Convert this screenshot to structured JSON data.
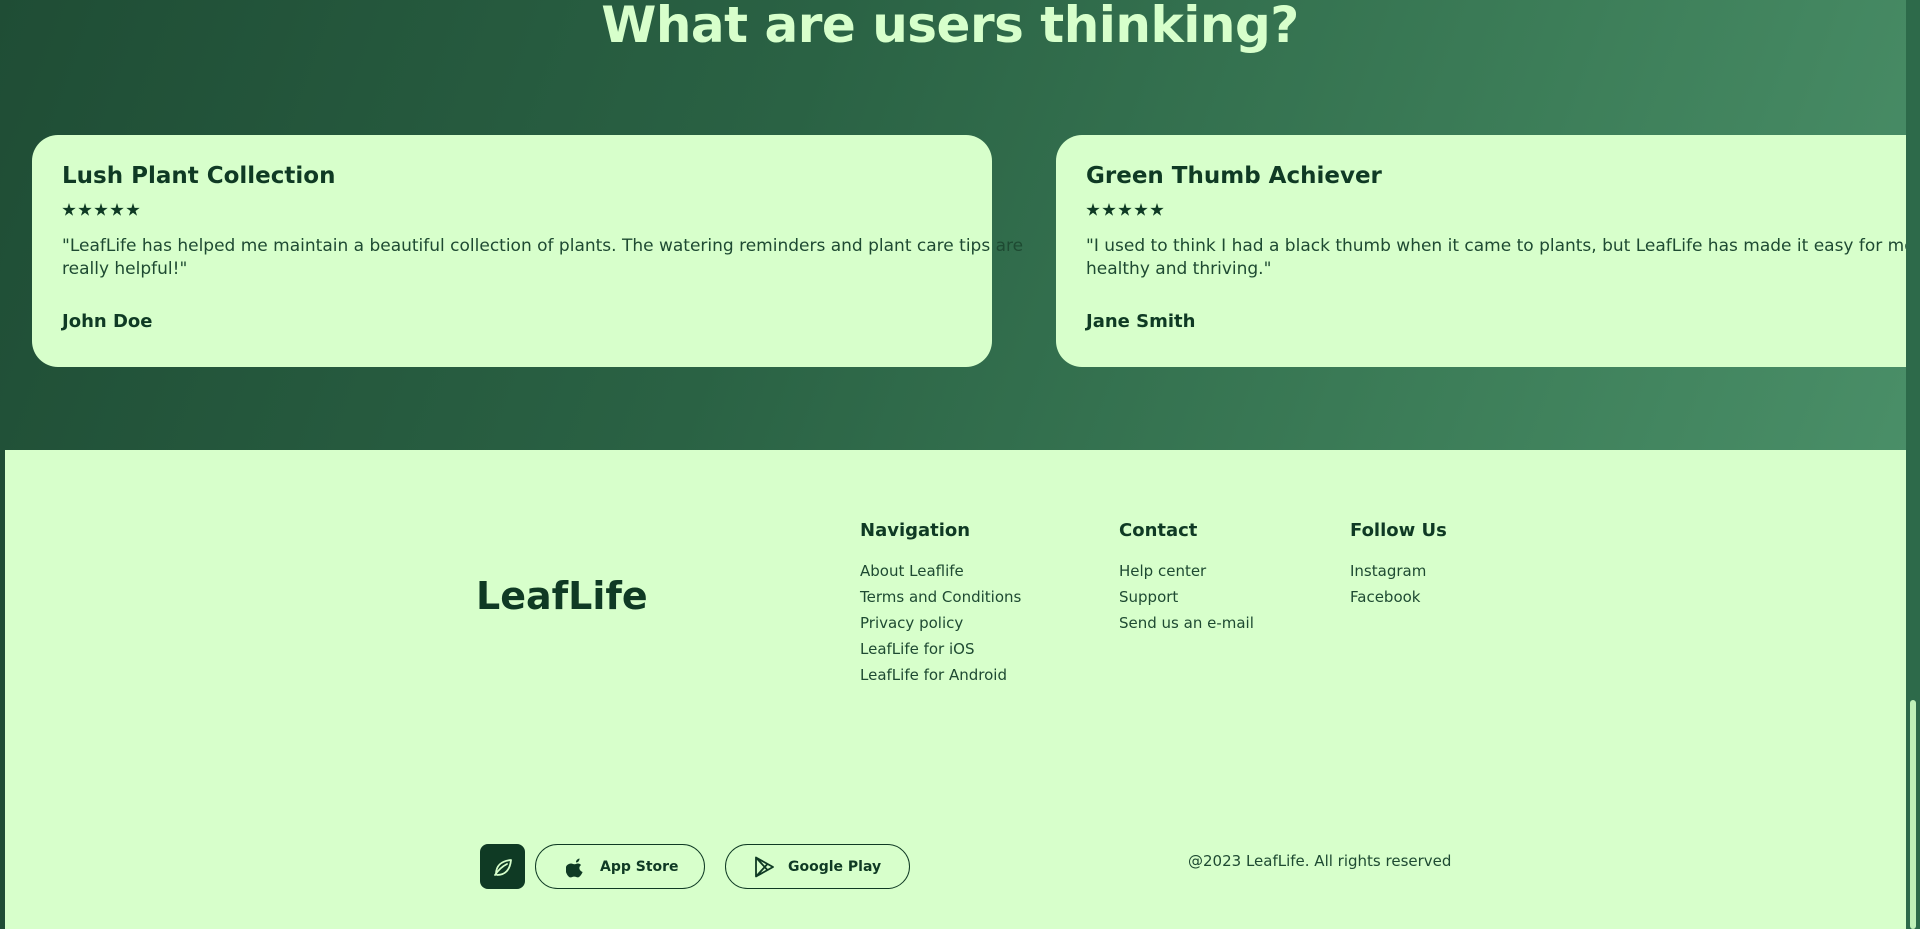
{
  "testimonials": {
    "title": "What are users thinking?",
    "cards": [
      {
        "title": "Lush Plant Collection",
        "rating": 5,
        "quote_line1": "\"LeafLife has helped me maintain a beautiful collection of plants. The watering reminders and plant care tips are",
        "quote_line2": "really helpful!\"",
        "author": "John Doe"
      },
      {
        "title": "Green Thumb Achiever",
        "rating": 5,
        "quote_line1": "\"I used to think I had a black thumb when it came to plants, but LeafLife has made it easy for me to keep",
        "quote_line2": "healthy and thriving.\"",
        "author": "Jane Smith"
      }
    ]
  },
  "footer": {
    "brand": "LeafLife",
    "navigation": {
      "title": "Navigation",
      "links": [
        "About Leaflife",
        "Terms and Conditions",
        "Privacy policy",
        "LeafLife for iOS",
        "LeafLife for Android"
      ]
    },
    "contact": {
      "title": "Contact",
      "links": [
        "Help center",
        "Support",
        "Send us an e-mail"
      ]
    },
    "follow": {
      "title": "Follow Us",
      "links": [
        "Instagram",
        "Facebook"
      ]
    },
    "app_store_label": "App Store",
    "google_play_label": "Google Play",
    "copyright": "@2023 LeafLife. All rights reserved"
  },
  "icons": {
    "leaf": "leaf-icon",
    "apple": "apple-icon",
    "play": "google-play-icon",
    "star": "star-icon"
  },
  "colors": {
    "dark_green": "#0f3a24",
    "light_green": "#d7ffcb",
    "bg_gradient_start": "#1f4d35",
    "bg_gradient_end": "#4a8f68"
  }
}
